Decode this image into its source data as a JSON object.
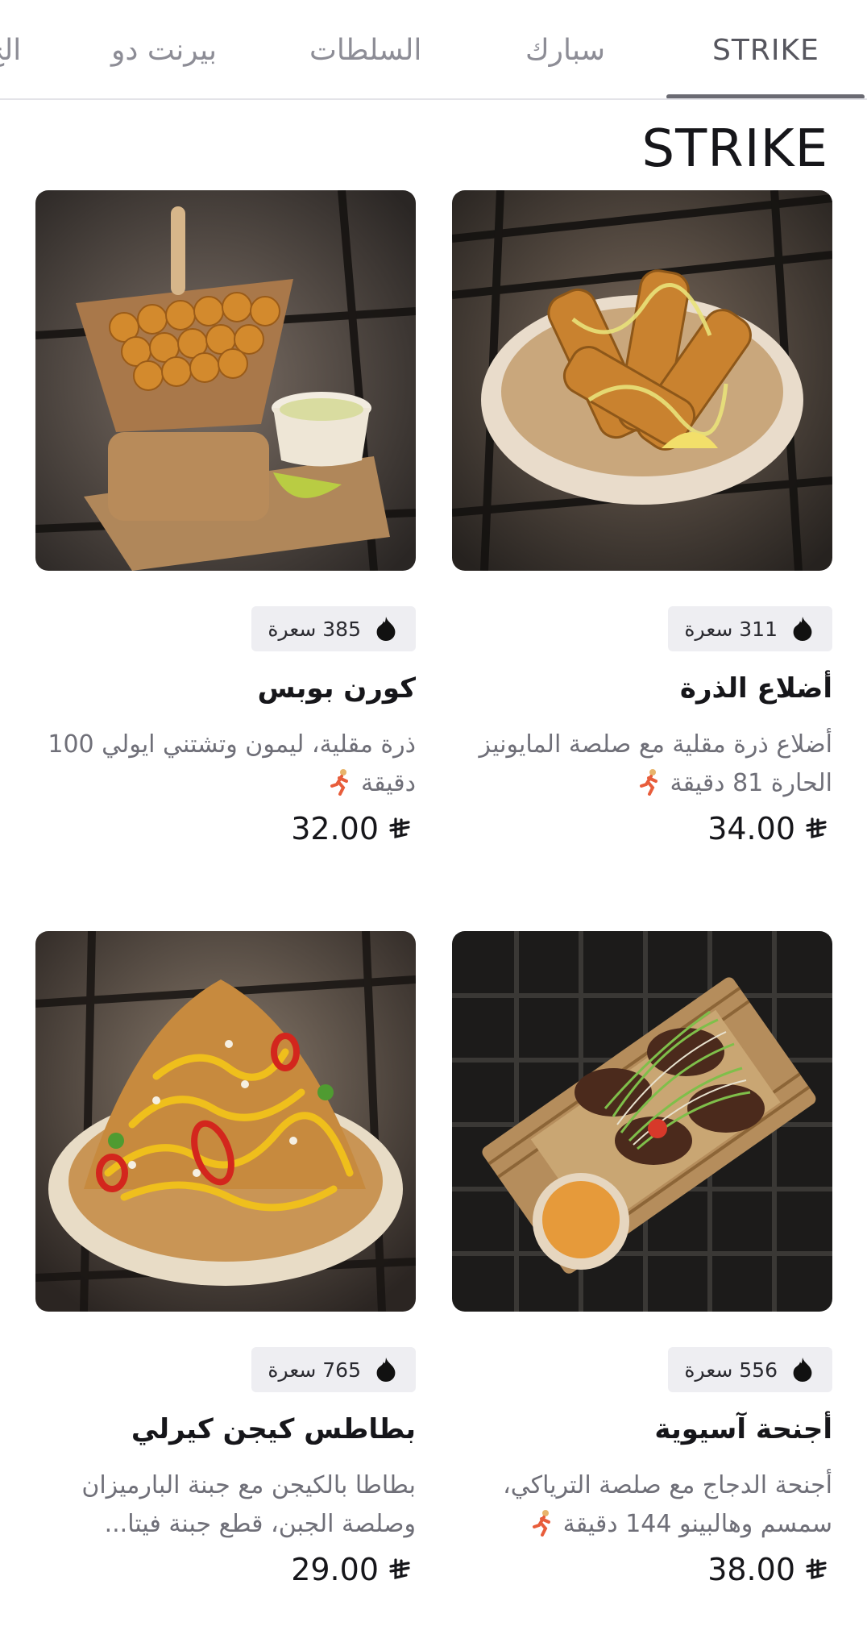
{
  "tabs": [
    {
      "label": "STRIKE",
      "active": true
    },
    {
      "label": "سبارك",
      "active": false
    },
    {
      "label": "السلطات",
      "active": false
    },
    {
      "label": "بيرنت دو",
      "active": false
    },
    {
      "label": "الح",
      "active": false
    }
  ],
  "section": {
    "title": "STRIKE"
  },
  "icons": {
    "calories": "fire-icon",
    "prep_time": "runner-icon",
    "currency": "riyal-icon"
  },
  "items": [
    {
      "calories": "311 سعرة",
      "name": "أضلاع الذرة",
      "description": "أضلاع ذرة مقلية مع صلصة المايونيز الحارة 81 دقيقة",
      "price": "34.00",
      "image": "corn-ribs-photo"
    },
    {
      "calories": "385 سعرة",
      "name": "كورن بوبس",
      "description": "ذرة مقلية، ليمون وتشتني ايولي 100 دقيقة",
      "price": "32.00",
      "image": "corn-pops-photo"
    },
    {
      "calories": "556 سعرة",
      "name": "أجنحة آسيوية",
      "description": "أجنحة الدجاج مع صلصة الترياكي، سمسم وهالبينو 144 دقيقة",
      "price": "38.00",
      "image": "asian-wings-photo"
    },
    {
      "calories": "765 سعرة",
      "name": "بطاطس كيجن كيرلي",
      "description": "بطاطا بالكيجن مع جبنة البارميزان وصلصة الجبن، قطع جبنة فيتا...",
      "price": "29.00",
      "image": "cajun-curly-fries-photo"
    }
  ]
}
